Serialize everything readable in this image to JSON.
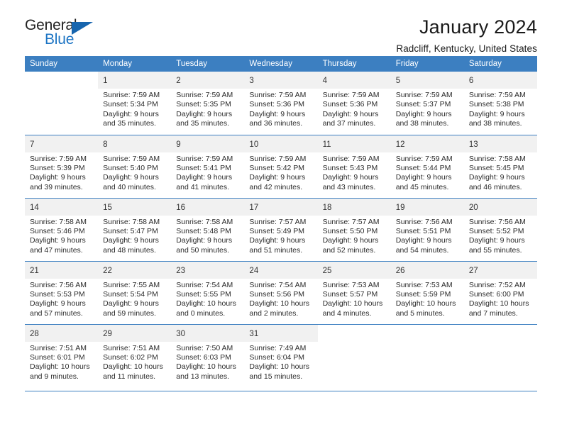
{
  "brand": {
    "word1": "General",
    "word2": "Blue",
    "triangle_color": "#1765ae",
    "blue_color": "#1c74c4"
  },
  "header": {
    "title": "January 2024",
    "subtitle": "Radcliff, Kentucky, United States"
  },
  "theme": {
    "header_row_bg": "#3c7fc1",
    "daynum_bg": "#f1f1f1",
    "grid_line": "#3c7fc1",
    "text": "#2b2b2b"
  },
  "columns": [
    "Sunday",
    "Monday",
    "Tuesday",
    "Wednesday",
    "Thursday",
    "Friday",
    "Saturday"
  ],
  "weeks": [
    [
      {
        "day": "",
        "blank": true,
        "sunrise": "",
        "sunset": "",
        "daylight_line1": "",
        "daylight_line2": ""
      },
      {
        "day": "1",
        "sunrise": "Sunrise: 7:59 AM",
        "sunset": "Sunset: 5:34 PM",
        "daylight_line1": "Daylight: 9 hours",
        "daylight_line2": "and 35 minutes."
      },
      {
        "day": "2",
        "sunrise": "Sunrise: 7:59 AM",
        "sunset": "Sunset: 5:35 PM",
        "daylight_line1": "Daylight: 9 hours",
        "daylight_line2": "and 35 minutes."
      },
      {
        "day": "3",
        "sunrise": "Sunrise: 7:59 AM",
        "sunset": "Sunset: 5:36 PM",
        "daylight_line1": "Daylight: 9 hours",
        "daylight_line2": "and 36 minutes."
      },
      {
        "day": "4",
        "sunrise": "Sunrise: 7:59 AM",
        "sunset": "Sunset: 5:36 PM",
        "daylight_line1": "Daylight: 9 hours",
        "daylight_line2": "and 37 minutes."
      },
      {
        "day": "5",
        "sunrise": "Sunrise: 7:59 AM",
        "sunset": "Sunset: 5:37 PM",
        "daylight_line1": "Daylight: 9 hours",
        "daylight_line2": "and 38 minutes."
      },
      {
        "day": "6",
        "sunrise": "Sunrise: 7:59 AM",
        "sunset": "Sunset: 5:38 PM",
        "daylight_line1": "Daylight: 9 hours",
        "daylight_line2": "and 38 minutes."
      }
    ],
    [
      {
        "day": "7",
        "sunrise": "Sunrise: 7:59 AM",
        "sunset": "Sunset: 5:39 PM",
        "daylight_line1": "Daylight: 9 hours",
        "daylight_line2": "and 39 minutes."
      },
      {
        "day": "8",
        "sunrise": "Sunrise: 7:59 AM",
        "sunset": "Sunset: 5:40 PM",
        "daylight_line1": "Daylight: 9 hours",
        "daylight_line2": "and 40 minutes."
      },
      {
        "day": "9",
        "sunrise": "Sunrise: 7:59 AM",
        "sunset": "Sunset: 5:41 PM",
        "daylight_line1": "Daylight: 9 hours",
        "daylight_line2": "and 41 minutes."
      },
      {
        "day": "10",
        "sunrise": "Sunrise: 7:59 AM",
        "sunset": "Sunset: 5:42 PM",
        "daylight_line1": "Daylight: 9 hours",
        "daylight_line2": "and 42 minutes."
      },
      {
        "day": "11",
        "sunrise": "Sunrise: 7:59 AM",
        "sunset": "Sunset: 5:43 PM",
        "daylight_line1": "Daylight: 9 hours",
        "daylight_line2": "and 43 minutes."
      },
      {
        "day": "12",
        "sunrise": "Sunrise: 7:59 AM",
        "sunset": "Sunset: 5:44 PM",
        "daylight_line1": "Daylight: 9 hours",
        "daylight_line2": "and 45 minutes."
      },
      {
        "day": "13",
        "sunrise": "Sunrise: 7:58 AM",
        "sunset": "Sunset: 5:45 PM",
        "daylight_line1": "Daylight: 9 hours",
        "daylight_line2": "and 46 minutes."
      }
    ],
    [
      {
        "day": "14",
        "sunrise": "Sunrise: 7:58 AM",
        "sunset": "Sunset: 5:46 PM",
        "daylight_line1": "Daylight: 9 hours",
        "daylight_line2": "and 47 minutes."
      },
      {
        "day": "15",
        "sunrise": "Sunrise: 7:58 AM",
        "sunset": "Sunset: 5:47 PM",
        "daylight_line1": "Daylight: 9 hours",
        "daylight_line2": "and 48 minutes."
      },
      {
        "day": "16",
        "sunrise": "Sunrise: 7:58 AM",
        "sunset": "Sunset: 5:48 PM",
        "daylight_line1": "Daylight: 9 hours",
        "daylight_line2": "and 50 minutes."
      },
      {
        "day": "17",
        "sunrise": "Sunrise: 7:57 AM",
        "sunset": "Sunset: 5:49 PM",
        "daylight_line1": "Daylight: 9 hours",
        "daylight_line2": "and 51 minutes."
      },
      {
        "day": "18",
        "sunrise": "Sunrise: 7:57 AM",
        "sunset": "Sunset: 5:50 PM",
        "daylight_line1": "Daylight: 9 hours",
        "daylight_line2": "and 52 minutes."
      },
      {
        "day": "19",
        "sunrise": "Sunrise: 7:56 AM",
        "sunset": "Sunset: 5:51 PM",
        "daylight_line1": "Daylight: 9 hours",
        "daylight_line2": "and 54 minutes."
      },
      {
        "day": "20",
        "sunrise": "Sunrise: 7:56 AM",
        "sunset": "Sunset: 5:52 PM",
        "daylight_line1": "Daylight: 9 hours",
        "daylight_line2": "and 55 minutes."
      }
    ],
    [
      {
        "day": "21",
        "sunrise": "Sunrise: 7:56 AM",
        "sunset": "Sunset: 5:53 PM",
        "daylight_line1": "Daylight: 9 hours",
        "daylight_line2": "and 57 minutes."
      },
      {
        "day": "22",
        "sunrise": "Sunrise: 7:55 AM",
        "sunset": "Sunset: 5:54 PM",
        "daylight_line1": "Daylight: 9 hours",
        "daylight_line2": "and 59 minutes."
      },
      {
        "day": "23",
        "sunrise": "Sunrise: 7:54 AM",
        "sunset": "Sunset: 5:55 PM",
        "daylight_line1": "Daylight: 10 hours",
        "daylight_line2": "and 0 minutes."
      },
      {
        "day": "24",
        "sunrise": "Sunrise: 7:54 AM",
        "sunset": "Sunset: 5:56 PM",
        "daylight_line1": "Daylight: 10 hours",
        "daylight_line2": "and 2 minutes."
      },
      {
        "day": "25",
        "sunrise": "Sunrise: 7:53 AM",
        "sunset": "Sunset: 5:57 PM",
        "daylight_line1": "Daylight: 10 hours",
        "daylight_line2": "and 4 minutes."
      },
      {
        "day": "26",
        "sunrise": "Sunrise: 7:53 AM",
        "sunset": "Sunset: 5:59 PM",
        "daylight_line1": "Daylight: 10 hours",
        "daylight_line2": "and 5 minutes."
      },
      {
        "day": "27",
        "sunrise": "Sunrise: 7:52 AM",
        "sunset": "Sunset: 6:00 PM",
        "daylight_line1": "Daylight: 10 hours",
        "daylight_line2": "and 7 minutes."
      }
    ],
    [
      {
        "day": "28",
        "sunrise": "Sunrise: 7:51 AM",
        "sunset": "Sunset: 6:01 PM",
        "daylight_line1": "Daylight: 10 hours",
        "daylight_line2": "and 9 minutes."
      },
      {
        "day": "29",
        "sunrise": "Sunrise: 7:51 AM",
        "sunset": "Sunset: 6:02 PM",
        "daylight_line1": "Daylight: 10 hours",
        "daylight_line2": "and 11 minutes."
      },
      {
        "day": "30",
        "sunrise": "Sunrise: 7:50 AM",
        "sunset": "Sunset: 6:03 PM",
        "daylight_line1": "Daylight: 10 hours",
        "daylight_line2": "and 13 minutes."
      },
      {
        "day": "31",
        "sunrise": "Sunrise: 7:49 AM",
        "sunset": "Sunset: 6:04 PM",
        "daylight_line1": "Daylight: 10 hours",
        "daylight_line2": "and 15 minutes."
      },
      {
        "day": "",
        "blank": true,
        "sunrise": "",
        "sunset": "",
        "daylight_line1": "",
        "daylight_line2": ""
      },
      {
        "day": "",
        "blank": true,
        "sunrise": "",
        "sunset": "",
        "daylight_line1": "",
        "daylight_line2": ""
      },
      {
        "day": "",
        "blank": true,
        "sunrise": "",
        "sunset": "",
        "daylight_line1": "",
        "daylight_line2": ""
      }
    ]
  ]
}
